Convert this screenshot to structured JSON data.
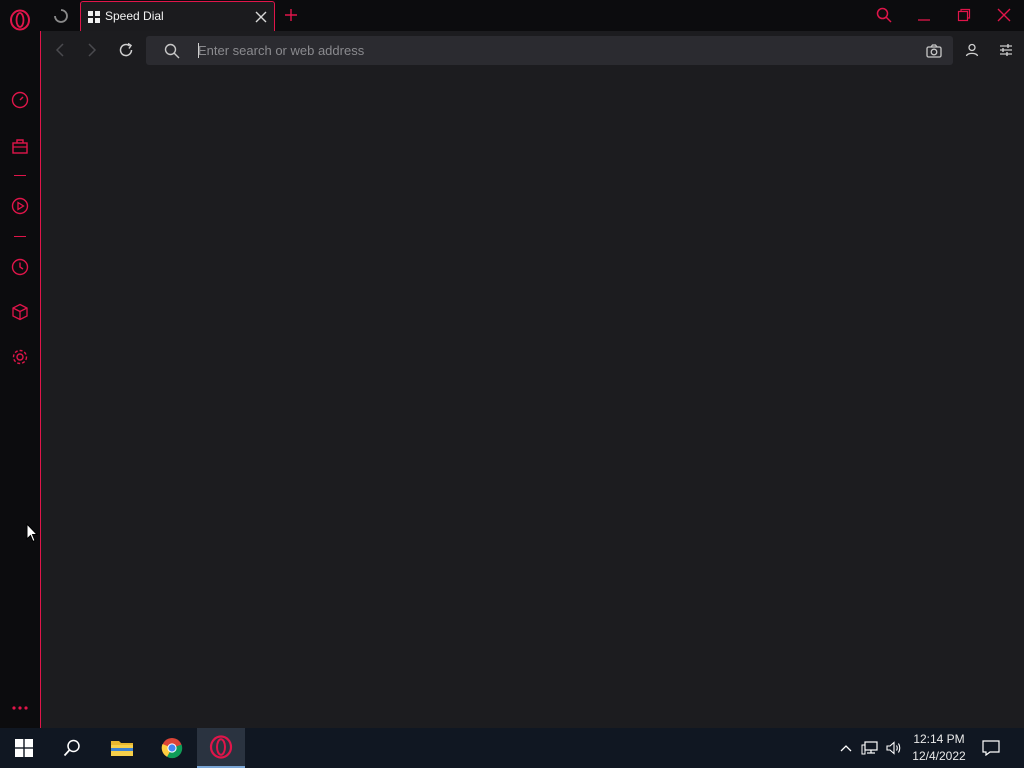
{
  "browser": {
    "tab": {
      "title": "Speed Dial"
    },
    "addressbar": {
      "placeholder": "Enter search or web address",
      "value": ""
    }
  },
  "sidebar": {
    "items": [
      {
        "name": "speed-dial",
        "icon": "speedometer-icon"
      },
      {
        "name": "workspace",
        "icon": "briefcase-icon"
      },
      {
        "name": "player",
        "icon": "play-circle-icon"
      },
      {
        "name": "history",
        "icon": "clock-icon"
      },
      {
        "name": "extensions",
        "icon": "cube-icon"
      },
      {
        "name": "settings",
        "icon": "gear-icon"
      }
    ]
  },
  "taskbar": {
    "clock": {
      "time": "12:14 PM",
      "date": "12/4/2022"
    }
  },
  "colors": {
    "accent": "#e0154a",
    "frame_bg": "#1c1c1f",
    "taskbar_bg": "#101722"
  }
}
